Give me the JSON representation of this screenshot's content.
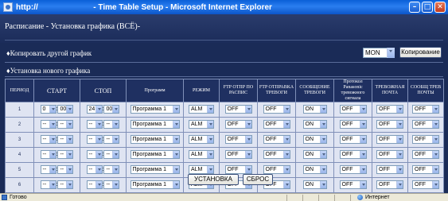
{
  "window": {
    "title": "http://             - Time Table Setup - Microsoft Internet Explorer",
    "minimize": "–",
    "maximize": "□",
    "close": "✕"
  },
  "page": {
    "title": "Расписание - Установка графика (ВСЁ)-"
  },
  "copy_section": {
    "label": "♦Копировать другой график",
    "day_value": "MON",
    "copy_button": "Копирование"
  },
  "new_section": {
    "label": "♦Установка нового графика"
  },
  "table": {
    "headers": {
      "period": "ПЕРИОД",
      "start": "СТАРТ",
      "stop": "СТОП",
      "program": "Программ",
      "mode": "РЕЖИМ",
      "ftp_alarm": "FTP ОТПР ПО РАСПИС",
      "ftp_send": "FTP ОТПРАВКА ТРЕВОГИ",
      "alarm_msg": "СООБЩЕНИЕ ТРЕВОГИ",
      "remote_alarm": "Протокол Panasonic тревожного сигнала",
      "alarm_mail": "ТРЕВОЖНАЯ ПОЧТА",
      "trouble_mail": "СООБЩ ТРЕВ ПОЧТЫ"
    },
    "rows": [
      {
        "num": "1",
        "sh": "0",
        "sm": "00",
        "eh": "24",
        "em": "00",
        "program": "Программа 1",
        "mode": "ALM",
        "ftp_alarm": "OFF",
        "ftp_send": "OFF",
        "alarm_msg": "ON",
        "remote_alarm": "OFF",
        "alarm_mail": "OFF",
        "trouble_mail": "OFF"
      },
      {
        "num": "2",
        "sh": "--",
        "sm": "--",
        "eh": "--",
        "em": "--",
        "program": "Программа 1",
        "mode": "ALM",
        "ftp_alarm": "OFF",
        "ftp_send": "OFF",
        "alarm_msg": "ON",
        "remote_alarm": "OFF",
        "alarm_mail": "OFF",
        "trouble_mail": "OFF"
      },
      {
        "num": "3",
        "sh": "--",
        "sm": "--",
        "eh": "--",
        "em": "--",
        "program": "Программа 1",
        "mode": "ALM",
        "ftp_alarm": "OFF",
        "ftp_send": "OFF",
        "alarm_msg": "ON",
        "remote_alarm": "OFF",
        "alarm_mail": "OFF",
        "trouble_mail": "OFF"
      },
      {
        "num": "4",
        "sh": "--",
        "sm": "--",
        "eh": "--",
        "em": "--",
        "program": "Программа 1",
        "mode": "ALM",
        "ftp_alarm": "OFF",
        "ftp_send": "OFF",
        "alarm_msg": "ON",
        "remote_alarm": "OFF",
        "alarm_mail": "OFF",
        "trouble_mail": "OFF"
      },
      {
        "num": "5",
        "sh": "--",
        "sm": "--",
        "eh": "--",
        "em": "--",
        "program": "Программа 1",
        "mode": "ALM",
        "ftp_alarm": "OFF",
        "ftp_send": "OFF",
        "alarm_msg": "ON",
        "remote_alarm": "OFF",
        "alarm_mail": "OFF",
        "trouble_mail": "OFF"
      },
      {
        "num": "6",
        "sh": "--",
        "sm": "--",
        "eh": "--",
        "em": "--",
        "program": "Программа 1",
        "mode": "ALM",
        "ftp_alarm": "OFF",
        "ftp_send": "OFF",
        "alarm_msg": "ON",
        "remote_alarm": "OFF",
        "alarm_mail": "OFF",
        "trouble_mail": "OFF"
      }
    ]
  },
  "buttons": {
    "set": "УСТАНОВКА",
    "reset": "СБРОС"
  },
  "statusbar": {
    "left": "Готово",
    "zone": "Интернет"
  }
}
